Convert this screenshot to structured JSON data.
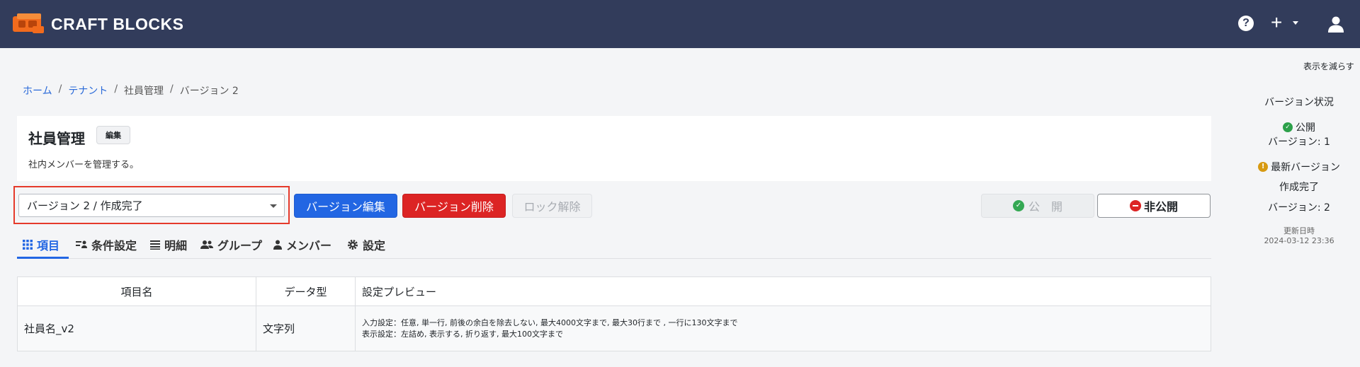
{
  "app": {
    "brand": "CRAFT BLOCKS"
  },
  "header": {
    "help_icon": "question-circle-icon",
    "add_icon": "plus-icon",
    "user_icon": "user-icon"
  },
  "breadcrumb": {
    "home": "ホーム",
    "tenant": "テナント",
    "current_app": "社員管理",
    "current_version": "バージョン 2",
    "separator": "/"
  },
  "page": {
    "title": "社員管理",
    "edit_badge": "編集",
    "description": "社内メンバーを管理する。"
  },
  "toolbar": {
    "version_select_value": "バージョン 2 / 作成完了",
    "edit_version": "バージョン編集",
    "delete_version": "バージョン削除",
    "unlock": "ロック解除",
    "publish": "公　開",
    "unpublish": "非公開"
  },
  "tabs": [
    {
      "label": "項目",
      "icon": "grid-icon"
    },
    {
      "label": "条件設定",
      "icon": "filter-user-icon"
    },
    {
      "label": "明細",
      "icon": "list-icon"
    },
    {
      "label": "グループ",
      "icon": "users-icon"
    },
    {
      "label": "メンバー",
      "icon": "user-icon"
    },
    {
      "label": "設定",
      "icon": "gear-icon"
    }
  ],
  "table": {
    "headers": [
      "項目名",
      "データ型",
      "設定プレビュー"
    ],
    "rows": [
      {
        "name": "社員名_v2",
        "type": "文字列",
        "preview_line1": "入力設定：任意, 単一行, 前後の余白を除去しない, 最大4000文字まで, 最大30行まで , 一行に130文字まで",
        "preview_line2": "表示設定：左詰め, 表示する, 折り返す, 最大100文字まで"
      }
    ]
  },
  "side_panel": {
    "reduce_link": "表示を減らす",
    "heading": "バージョン状況",
    "published_label": "公開",
    "published_version": "バージョン: 1",
    "latest_label": "最新バージョン",
    "latest_status": "作成完了",
    "latest_version": "バージョン: 2",
    "updated_label": "更新日時",
    "updated_at": "2024-03-12 23:36"
  },
  "colors": {
    "header_bg": "#323c5b",
    "primary": "#2266e3",
    "danger": "#dc2424",
    "success": "#2ca04a",
    "warning": "#d79a12",
    "highlight": "#e53a2b"
  }
}
